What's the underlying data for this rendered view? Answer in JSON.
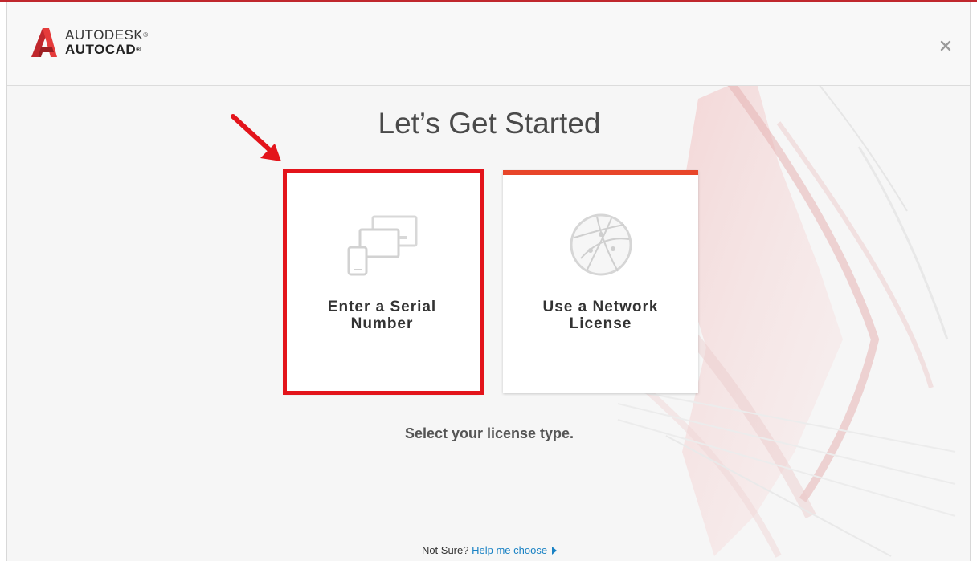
{
  "header": {
    "brand": "AUTODESK",
    "product": "AUTOCAD",
    "logo_icon": "autocad-a-logo-icon",
    "close_icon": "close-icon"
  },
  "main": {
    "title": "Let’s Get Started",
    "subtitle": "Select your license type.",
    "tiles": [
      {
        "label": "Enter a Serial\nNumber",
        "icon": "devices-icon",
        "highlighted": true
      },
      {
        "label": "Use a Network\nLicense",
        "icon": "network-globe-icon",
        "accent": "#e8462a"
      }
    ]
  },
  "footer": {
    "prompt": "Not Sure?",
    "link": "Help me choose"
  },
  "colors": {
    "accent": "#e8462a",
    "highlight": "#e3141b",
    "link": "#1a82c4",
    "brand_red": "#c0272d"
  }
}
